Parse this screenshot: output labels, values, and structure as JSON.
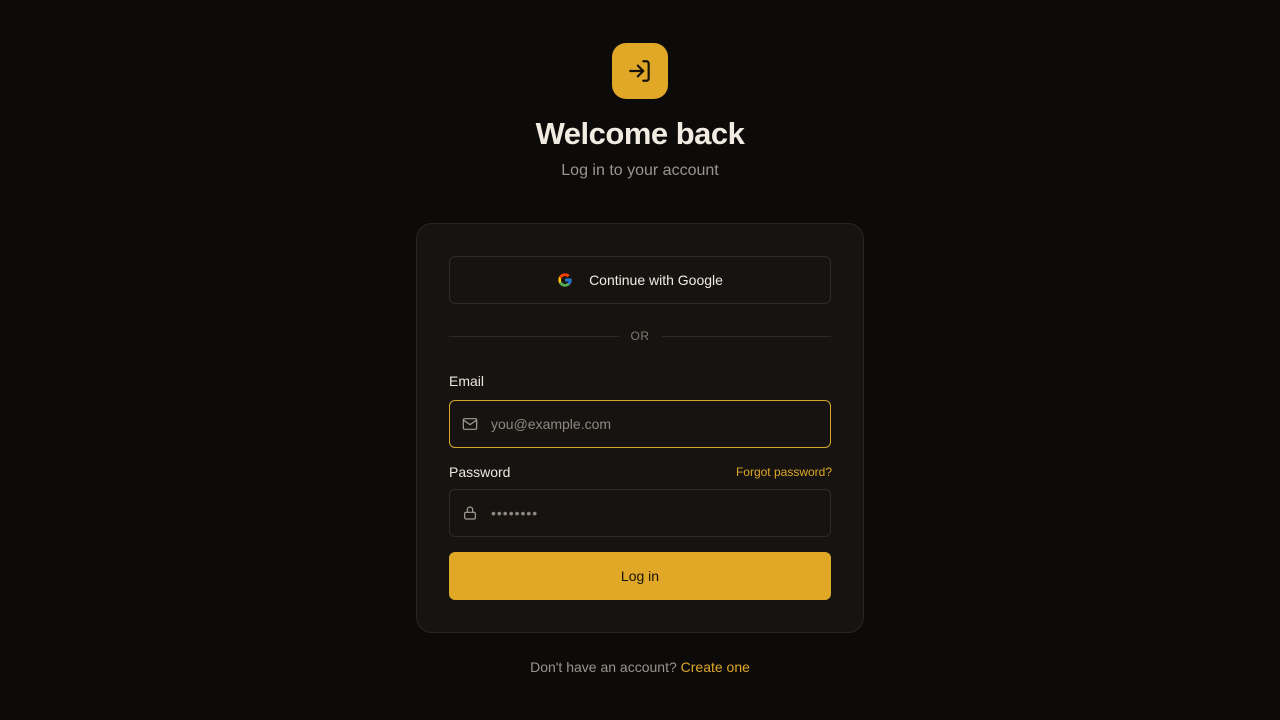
{
  "header": {
    "logo_icon": "log-in-icon",
    "title": "Welcome back",
    "subtitle": "Log in to your account"
  },
  "card": {
    "google_button": {
      "label": "Continue with Google",
      "icon": "google-icon"
    },
    "divider_text": "OR",
    "email": {
      "label": "Email",
      "placeholder": "you@example.com",
      "value": "",
      "icon": "mail-icon"
    },
    "password": {
      "label": "Password",
      "placeholder": "••••••••",
      "value": "",
      "icon": "lock-icon",
      "forgot_label": "Forgot password?"
    },
    "submit_label": "Log in"
  },
  "footer": {
    "prompt": "Don't have an account?",
    "link_label": "Create one"
  },
  "colors": {
    "background": "#0c0b0a",
    "card": "#161311",
    "accent": "#e0a826",
    "text": "#f1ebe2",
    "muted": "#9a948c"
  }
}
